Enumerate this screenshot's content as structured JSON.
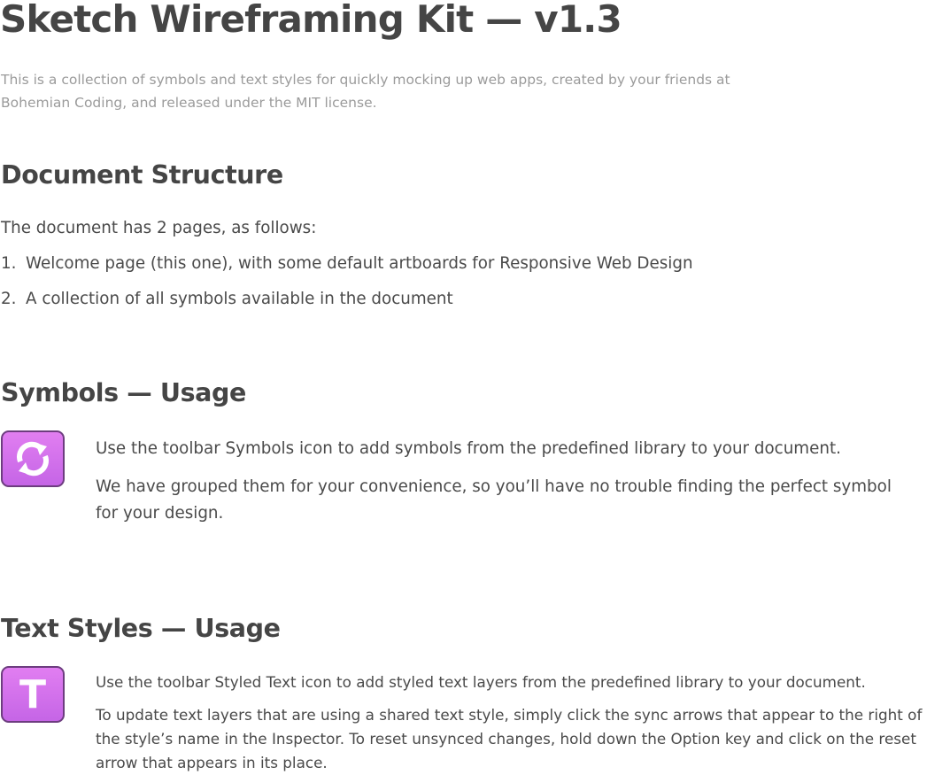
{
  "header": {
    "title": "Sketch Wireframing Kit — v1.3",
    "intro": "This is a collection of symbols and text styles for quickly mocking up web apps, created by your friends at Bohemian Coding, and released under the MIT license."
  },
  "document_structure": {
    "heading": "Document Structure",
    "lead": "The document has 2 pages, as follows:",
    "items": [
      {
        "number": "1.",
        "text": "Welcome page (this one), with some default artboards for Responsive Web Design"
      },
      {
        "number": "2.",
        "text": "A collection of all symbols available in the document"
      }
    ]
  },
  "symbols_usage": {
    "heading": "Symbols — Usage",
    "icon": "sync-arrows-icon",
    "paragraph_1": "Use the toolbar Symbols icon to add symbols from the predefined library to your document.",
    "paragraph_2": "We have grouped them for your convenience, so you’ll have no trouble finding the perfect symbol for your design."
  },
  "text_styles_usage": {
    "heading": "Text Styles — Usage",
    "icon": "text-t-icon",
    "icon_glyph": "T",
    "paragraph_1": "Use the toolbar Styled Text icon to add styled text layers  from the predefined library to your document.",
    "paragraph_2": "To update text layers that are using a shared text style, simply click the sync arrows that appear to the right of the style’s name in the Inspector. To reset unsynced changes, hold down the Option key and click on the reset arrow that appears in its place."
  },
  "colors": {
    "heading": "#454545",
    "body": "#4a4a4a",
    "muted": "#9b9b9b",
    "icon_fill": "#d573ec",
    "icon_border": "#6d3d7f"
  }
}
